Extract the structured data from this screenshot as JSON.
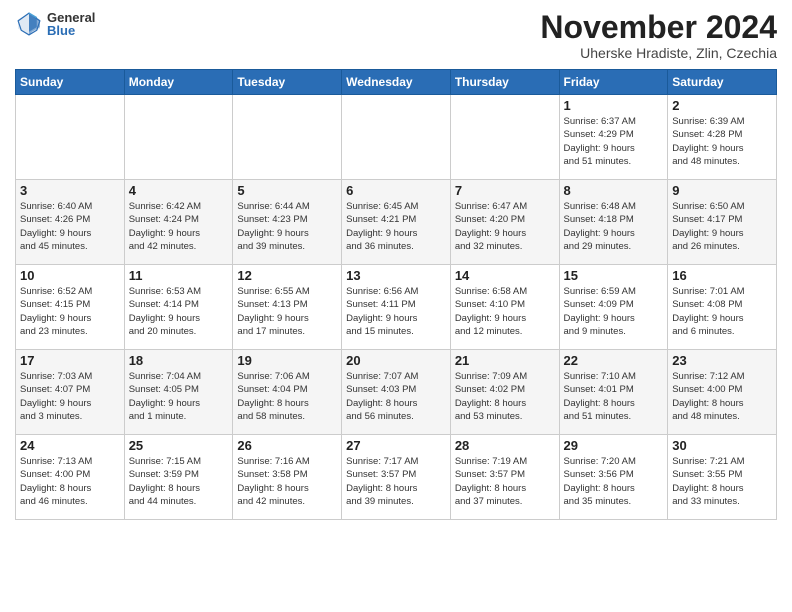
{
  "header": {
    "logo_general": "General",
    "logo_blue": "Blue",
    "month_title": "November 2024",
    "subtitle": "Uherske Hradiste, Zlin, Czechia"
  },
  "calendar": {
    "days_of_week": [
      "Sunday",
      "Monday",
      "Tuesday",
      "Wednesday",
      "Thursday",
      "Friday",
      "Saturday"
    ],
    "weeks": [
      [
        {
          "day": "",
          "info": ""
        },
        {
          "day": "",
          "info": ""
        },
        {
          "day": "",
          "info": ""
        },
        {
          "day": "",
          "info": ""
        },
        {
          "day": "",
          "info": ""
        },
        {
          "day": "1",
          "info": "Sunrise: 6:37 AM\nSunset: 4:29 PM\nDaylight: 9 hours\nand 51 minutes."
        },
        {
          "day": "2",
          "info": "Sunrise: 6:39 AM\nSunset: 4:28 PM\nDaylight: 9 hours\nand 48 minutes."
        }
      ],
      [
        {
          "day": "3",
          "info": "Sunrise: 6:40 AM\nSunset: 4:26 PM\nDaylight: 9 hours\nand 45 minutes."
        },
        {
          "day": "4",
          "info": "Sunrise: 6:42 AM\nSunset: 4:24 PM\nDaylight: 9 hours\nand 42 minutes."
        },
        {
          "day": "5",
          "info": "Sunrise: 6:44 AM\nSunset: 4:23 PM\nDaylight: 9 hours\nand 39 minutes."
        },
        {
          "day": "6",
          "info": "Sunrise: 6:45 AM\nSunset: 4:21 PM\nDaylight: 9 hours\nand 36 minutes."
        },
        {
          "day": "7",
          "info": "Sunrise: 6:47 AM\nSunset: 4:20 PM\nDaylight: 9 hours\nand 32 minutes."
        },
        {
          "day": "8",
          "info": "Sunrise: 6:48 AM\nSunset: 4:18 PM\nDaylight: 9 hours\nand 29 minutes."
        },
        {
          "day": "9",
          "info": "Sunrise: 6:50 AM\nSunset: 4:17 PM\nDaylight: 9 hours\nand 26 minutes."
        }
      ],
      [
        {
          "day": "10",
          "info": "Sunrise: 6:52 AM\nSunset: 4:15 PM\nDaylight: 9 hours\nand 23 minutes."
        },
        {
          "day": "11",
          "info": "Sunrise: 6:53 AM\nSunset: 4:14 PM\nDaylight: 9 hours\nand 20 minutes."
        },
        {
          "day": "12",
          "info": "Sunrise: 6:55 AM\nSunset: 4:13 PM\nDaylight: 9 hours\nand 17 minutes."
        },
        {
          "day": "13",
          "info": "Sunrise: 6:56 AM\nSunset: 4:11 PM\nDaylight: 9 hours\nand 15 minutes."
        },
        {
          "day": "14",
          "info": "Sunrise: 6:58 AM\nSunset: 4:10 PM\nDaylight: 9 hours\nand 12 minutes."
        },
        {
          "day": "15",
          "info": "Sunrise: 6:59 AM\nSunset: 4:09 PM\nDaylight: 9 hours\nand 9 minutes."
        },
        {
          "day": "16",
          "info": "Sunrise: 7:01 AM\nSunset: 4:08 PM\nDaylight: 9 hours\nand 6 minutes."
        }
      ],
      [
        {
          "day": "17",
          "info": "Sunrise: 7:03 AM\nSunset: 4:07 PM\nDaylight: 9 hours\nand 3 minutes."
        },
        {
          "day": "18",
          "info": "Sunrise: 7:04 AM\nSunset: 4:05 PM\nDaylight: 9 hours\nand 1 minute."
        },
        {
          "day": "19",
          "info": "Sunrise: 7:06 AM\nSunset: 4:04 PM\nDaylight: 8 hours\nand 58 minutes."
        },
        {
          "day": "20",
          "info": "Sunrise: 7:07 AM\nSunset: 4:03 PM\nDaylight: 8 hours\nand 56 minutes."
        },
        {
          "day": "21",
          "info": "Sunrise: 7:09 AM\nSunset: 4:02 PM\nDaylight: 8 hours\nand 53 minutes."
        },
        {
          "day": "22",
          "info": "Sunrise: 7:10 AM\nSunset: 4:01 PM\nDaylight: 8 hours\nand 51 minutes."
        },
        {
          "day": "23",
          "info": "Sunrise: 7:12 AM\nSunset: 4:00 PM\nDaylight: 8 hours\nand 48 minutes."
        }
      ],
      [
        {
          "day": "24",
          "info": "Sunrise: 7:13 AM\nSunset: 4:00 PM\nDaylight: 8 hours\nand 46 minutes."
        },
        {
          "day": "25",
          "info": "Sunrise: 7:15 AM\nSunset: 3:59 PM\nDaylight: 8 hours\nand 44 minutes."
        },
        {
          "day": "26",
          "info": "Sunrise: 7:16 AM\nSunset: 3:58 PM\nDaylight: 8 hours\nand 42 minutes."
        },
        {
          "day": "27",
          "info": "Sunrise: 7:17 AM\nSunset: 3:57 PM\nDaylight: 8 hours\nand 39 minutes."
        },
        {
          "day": "28",
          "info": "Sunrise: 7:19 AM\nSunset: 3:57 PM\nDaylight: 8 hours\nand 37 minutes."
        },
        {
          "day": "29",
          "info": "Sunrise: 7:20 AM\nSunset: 3:56 PM\nDaylight: 8 hours\nand 35 minutes."
        },
        {
          "day": "30",
          "info": "Sunrise: 7:21 AM\nSunset: 3:55 PM\nDaylight: 8 hours\nand 33 minutes."
        }
      ]
    ]
  }
}
